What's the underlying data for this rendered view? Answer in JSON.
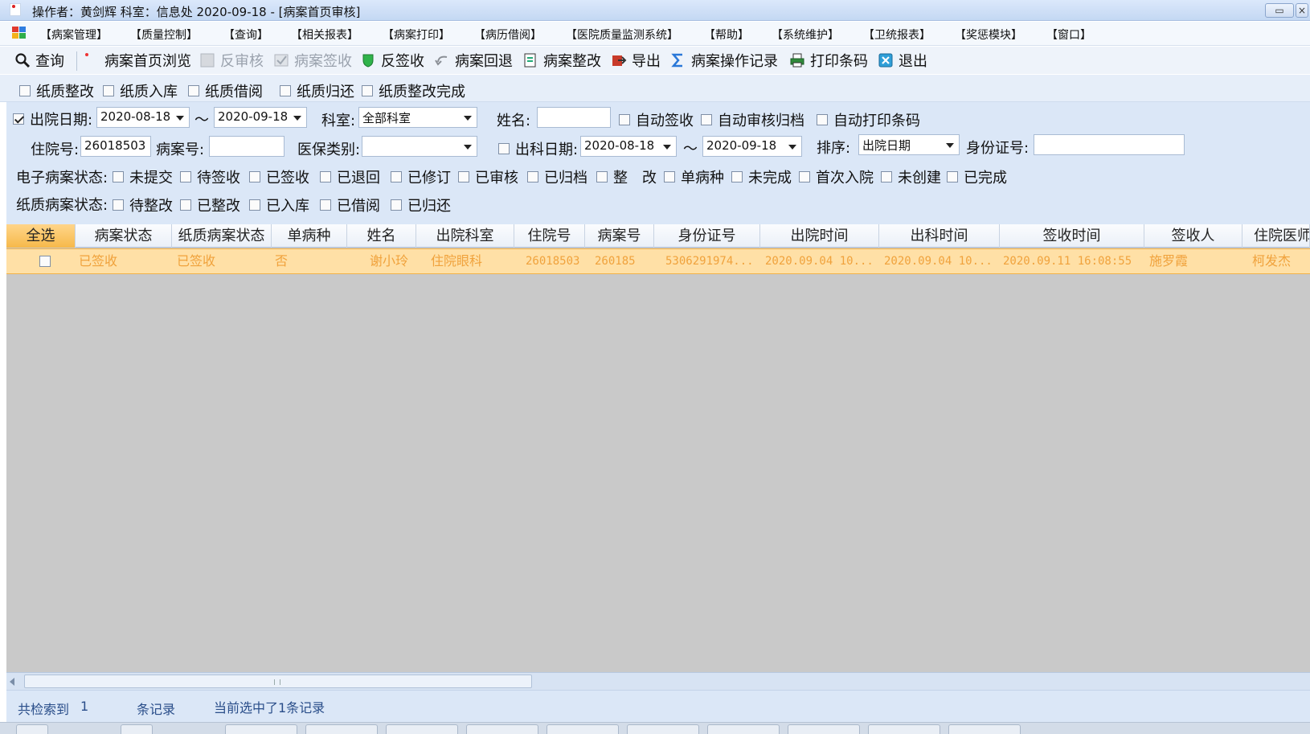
{
  "window": {
    "title": "操作者：黄剑辉  科室：信息处  2020-09-18 - [病案首页审核]",
    "restore_label": "▭",
    "close_label": "×"
  },
  "menu": {
    "items": [
      "【病案管理】",
      "【质量控制】",
      "【查询】",
      "【相关报表】",
      "【病案打印】",
      "【病历借阅】",
      "【医院质量监测系统】",
      "【帮助】",
      "【系统维护】",
      "【卫统报表】",
      "【奖惩模块】",
      "【窗口】"
    ]
  },
  "toolbar": {
    "query": "查询",
    "browse": "病案首页浏览",
    "reverse_audit": "反审核",
    "sign": "病案签收",
    "reverse_sign": "反签收",
    "return": "病案回退",
    "rectify": "病案整改",
    "export": "导出",
    "op_log": "病案操作记录",
    "print_barcode": "打印条码",
    "exit": "退出"
  },
  "paper_actions": [
    "纸质整改",
    "纸质入库",
    "纸质借阅",
    "纸质归还",
    "纸质整改完成"
  ],
  "filters": {
    "discharge_date_label": "出院日期:",
    "discharge_date_checked": true,
    "discharge_from": "2020-08-18",
    "discharge_to": "2020-09-18",
    "tilde": "～",
    "dept_label": "科室:",
    "dept_value": "全部科室",
    "name_label": "姓名:",
    "name_value": "",
    "auto_sign": "自动签收",
    "auto_audit_archive": "自动审核归档",
    "auto_print_barcode": "自动打印条码",
    "inpatient_no_label": "住院号:",
    "inpatient_no_value": "26018503",
    "case_no_label": "病案号:",
    "case_no_value": "",
    "insurance_label": "医保类别:",
    "insurance_value": "",
    "dept_out_date_label": "出科日期:",
    "dept_out_from": "2020-08-18",
    "dept_out_to": "2020-09-18",
    "sort_label": "排序:",
    "sort_value": "出院日期",
    "id_card_label": "身份证号:",
    "id_card_value": "",
    "e_status_label": "电子病案状态:",
    "e_status": [
      "未提交",
      "待签收",
      "已签收",
      "已退回",
      "已修订",
      "已审核",
      "已归档",
      "整　改",
      "单病种",
      "未完成",
      "首次入院",
      "未创建",
      "已完成"
    ],
    "paper_status_label": "纸质病案状态:",
    "paper_status": [
      "待整改",
      "已整改",
      "已入库",
      "已借阅",
      "已归还"
    ]
  },
  "grid": {
    "columns": [
      "全选",
      "病案状态",
      "纸质病案状态",
      "单病种",
      "姓名",
      "出院科室",
      "住院号",
      "病案号",
      "身份证号",
      "出院时间",
      "出科时间",
      "签收时间",
      "签收人",
      "住院医师"
    ],
    "rows": [
      {
        "case_status": "已签收",
        "paper_status": "已签收",
        "single_disease": "否",
        "name": "谢小玲",
        "dept": "住院眼科",
        "inpatient_no": "26018503",
        "case_no": "260185",
        "id_card": "5306291974...",
        "discharge_time": "2020.09.04 10...",
        "dept_out_time": "2020.09.04 10...",
        "sign_time": "2020.09.11 16:08:55",
        "signer": "施罗霞",
        "doctor": "柯发杰"
      }
    ]
  },
  "status": {
    "found_prefix": "共检索到",
    "found_count": "1",
    "found_suffix": "条记录",
    "selected_text": "当前选中了1条记录"
  },
  "colors": {
    "selected_row_bg": "#ffe0a6",
    "selected_row_text": "#f0a23c",
    "panel_bg": "#dbe7f7",
    "grid_bg": "#c9c9c9",
    "status_text": "#2a4e8a"
  }
}
